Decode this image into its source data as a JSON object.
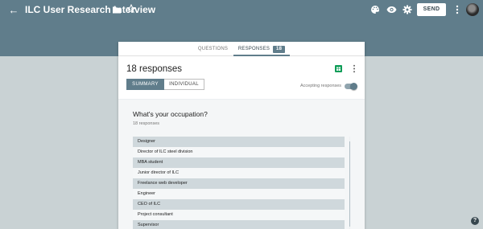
{
  "header": {
    "title": "ILC User Research Interview",
    "send_label": "SEND",
    "icons": [
      "back-arrow-icon",
      "folder-icon",
      "star-icon",
      "palette-icon",
      "eye-icon",
      "gear-icon",
      "more-vert-icon"
    ],
    "bar_color": "#607d8b"
  },
  "tabs": {
    "questions": "QUESTIONS",
    "responses": "RESPONSES",
    "responses_count": "18"
  },
  "summary": {
    "title": "18 responses",
    "summary_tab": "SUMMARY",
    "individual_tab": "INDIVIDUAL",
    "accepting_label": "Accepting responses",
    "accepting": true
  },
  "question": {
    "title": "What's your occupation?",
    "count_label": "18 responses",
    "answers": [
      "Designer",
      "Director of ILC steel division",
      "MBA student",
      "Junior director of ILC",
      "Freelance web developer",
      "Engineer",
      "CEO of ILC",
      "Project consultant",
      "Supervisor"
    ]
  },
  "help_label": "?"
}
